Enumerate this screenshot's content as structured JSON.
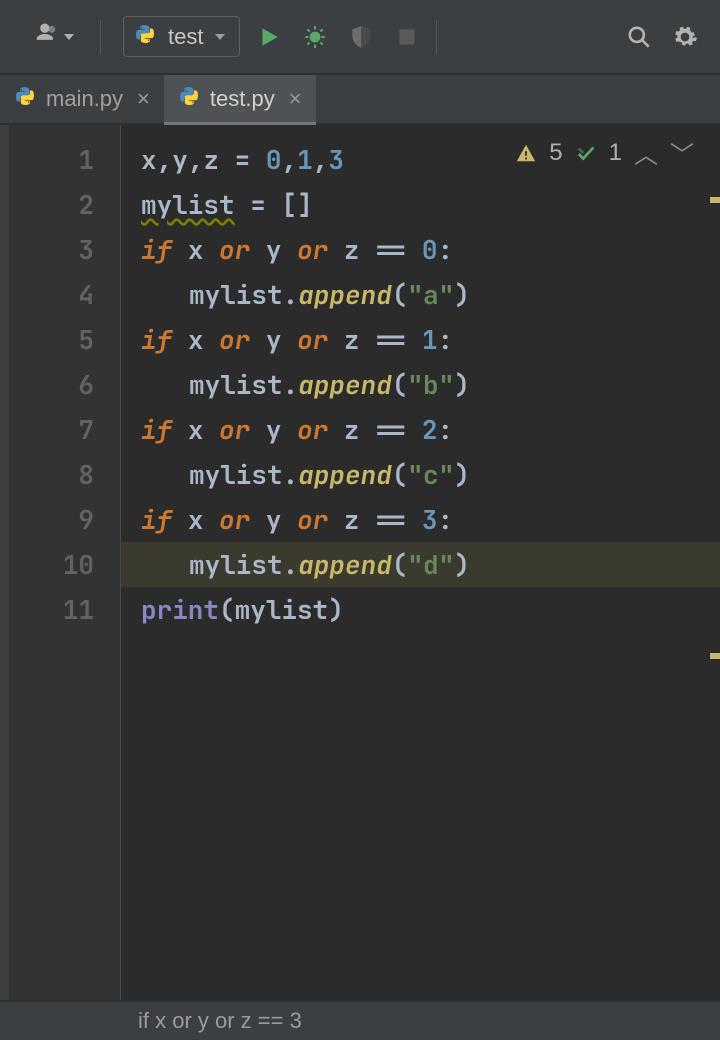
{
  "toolbar": {
    "run_config_label": "test"
  },
  "tabs": [
    {
      "label": "main.py",
      "active": false
    },
    {
      "label": "test.py",
      "active": true
    }
  ],
  "inspections": {
    "warnings": "5",
    "weak": "1"
  },
  "breadcrumb": "if x or y or z == 3",
  "code": {
    "highlighted_line": 10,
    "lines": [
      {
        "n": 1,
        "tokens": [
          {
            "t": "x",
            "c": "ident"
          },
          {
            "t": ",",
            "c": "op"
          },
          {
            "t": "y",
            "c": "ident"
          },
          {
            "t": ",",
            "c": "op"
          },
          {
            "t": "z",
            "c": "ident"
          },
          {
            "t": " ",
            "c": "op"
          },
          {
            "t": "=",
            "c": "op"
          },
          {
            "t": " ",
            "c": "op"
          },
          {
            "t": "0",
            "c": "num"
          },
          {
            "t": ",",
            "c": "op"
          },
          {
            "t": "1",
            "c": "num"
          },
          {
            "t": ",",
            "c": "op"
          },
          {
            "t": "3",
            "c": "num"
          }
        ]
      },
      {
        "n": 2,
        "tokens": [
          {
            "t": "mylist",
            "c": "ident warn-u"
          },
          {
            "t": " ",
            "c": "op"
          },
          {
            "t": "=",
            "c": "op"
          },
          {
            "t": " ",
            "c": "op"
          },
          {
            "t": "[]",
            "c": "op"
          }
        ]
      },
      {
        "n": 3,
        "tokens": [
          {
            "t": "if",
            "c": "kw"
          },
          {
            "t": " ",
            "c": "op"
          },
          {
            "t": "x",
            "c": "ident"
          },
          {
            "t": " ",
            "c": "op"
          },
          {
            "t": "or",
            "c": "kw"
          },
          {
            "t": " ",
            "c": "op"
          },
          {
            "t": "y",
            "c": "ident"
          },
          {
            "t": " ",
            "c": "op"
          },
          {
            "t": "or",
            "c": "kw"
          },
          {
            "t": " ",
            "c": "op"
          },
          {
            "t": "z",
            "c": "ident"
          },
          {
            "t": " ",
            "c": "op"
          },
          {
            "t": "==",
            "c": "op"
          },
          {
            "t": " ",
            "c": "op"
          },
          {
            "t": "0",
            "c": "num"
          },
          {
            "t": ":",
            "c": "op"
          }
        ]
      },
      {
        "n": 4,
        "indent": 1,
        "tokens": [
          {
            "t": "mylist",
            "c": "ident"
          },
          {
            "t": ".",
            "c": "dot"
          },
          {
            "t": "append",
            "c": "func"
          },
          {
            "t": "(",
            "c": "op"
          },
          {
            "t": "\"a\"",
            "c": "str"
          },
          {
            "t": ")",
            "c": "op"
          }
        ]
      },
      {
        "n": 5,
        "tokens": [
          {
            "t": "if",
            "c": "kw"
          },
          {
            "t": " ",
            "c": "op"
          },
          {
            "t": "x",
            "c": "ident"
          },
          {
            "t": " ",
            "c": "op"
          },
          {
            "t": "or",
            "c": "kw"
          },
          {
            "t": " ",
            "c": "op"
          },
          {
            "t": "y",
            "c": "ident"
          },
          {
            "t": " ",
            "c": "op"
          },
          {
            "t": "or",
            "c": "kw"
          },
          {
            "t": " ",
            "c": "op"
          },
          {
            "t": "z",
            "c": "ident"
          },
          {
            "t": " ",
            "c": "op"
          },
          {
            "t": "==",
            "c": "op"
          },
          {
            "t": " ",
            "c": "op"
          },
          {
            "t": "1",
            "c": "num"
          },
          {
            "t": ":",
            "c": "op"
          }
        ]
      },
      {
        "n": 6,
        "indent": 1,
        "tokens": [
          {
            "t": "mylist",
            "c": "ident"
          },
          {
            "t": ".",
            "c": "dot"
          },
          {
            "t": "append",
            "c": "func"
          },
          {
            "t": "(",
            "c": "op"
          },
          {
            "t": "\"b\"",
            "c": "str"
          },
          {
            "t": ")",
            "c": "op"
          }
        ]
      },
      {
        "n": 7,
        "tokens": [
          {
            "t": "if",
            "c": "kw"
          },
          {
            "t": " ",
            "c": "op"
          },
          {
            "t": "x",
            "c": "ident"
          },
          {
            "t": " ",
            "c": "op"
          },
          {
            "t": "or",
            "c": "kw"
          },
          {
            "t": " ",
            "c": "op"
          },
          {
            "t": "y",
            "c": "ident"
          },
          {
            "t": " ",
            "c": "op"
          },
          {
            "t": "or",
            "c": "kw"
          },
          {
            "t": " ",
            "c": "op"
          },
          {
            "t": "z",
            "c": "ident"
          },
          {
            "t": " ",
            "c": "op"
          },
          {
            "t": "==",
            "c": "op"
          },
          {
            "t": " ",
            "c": "op"
          },
          {
            "t": "2",
            "c": "num"
          },
          {
            "t": ":",
            "c": "op"
          }
        ]
      },
      {
        "n": 8,
        "indent": 1,
        "tokens": [
          {
            "t": "mylist",
            "c": "ident"
          },
          {
            "t": ".",
            "c": "dot"
          },
          {
            "t": "append",
            "c": "func"
          },
          {
            "t": "(",
            "c": "op"
          },
          {
            "t": "\"c\"",
            "c": "str"
          },
          {
            "t": ")",
            "c": "op"
          }
        ]
      },
      {
        "n": 9,
        "tokens": [
          {
            "t": "if",
            "c": "kw"
          },
          {
            "t": " ",
            "c": "op"
          },
          {
            "t": "x",
            "c": "ident"
          },
          {
            "t": " ",
            "c": "op"
          },
          {
            "t": "or",
            "c": "kw"
          },
          {
            "t": " ",
            "c": "op"
          },
          {
            "t": "y",
            "c": "ident"
          },
          {
            "t": " ",
            "c": "op"
          },
          {
            "t": "or",
            "c": "kw"
          },
          {
            "t": " ",
            "c": "op"
          },
          {
            "t": "z",
            "c": "ident"
          },
          {
            "t": " ",
            "c": "op"
          },
          {
            "t": "==",
            "c": "op"
          },
          {
            "t": " ",
            "c": "op"
          },
          {
            "t": "3",
            "c": "num"
          },
          {
            "t": ":",
            "c": "op"
          }
        ]
      },
      {
        "n": 10,
        "indent": 1,
        "tokens": [
          {
            "t": "mylist",
            "c": "ident"
          },
          {
            "t": ".",
            "c": "dot"
          },
          {
            "t": "append",
            "c": "func"
          },
          {
            "t": "(",
            "c": "op"
          },
          {
            "t": "\"d\"",
            "c": "str"
          },
          {
            "t": ")",
            "c": "op"
          }
        ]
      },
      {
        "n": 11,
        "tokens": [
          {
            "t": "print",
            "c": "builtin"
          },
          {
            "t": "(",
            "c": "op"
          },
          {
            "t": "mylist",
            "c": "ident"
          },
          {
            "t": ")",
            "c": "op"
          }
        ]
      }
    ]
  }
}
